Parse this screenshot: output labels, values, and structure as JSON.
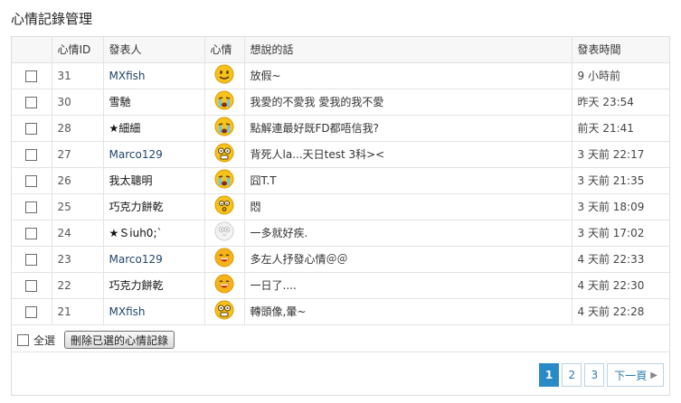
{
  "page": {
    "title": "心情記錄管理"
  },
  "table": {
    "headers": {
      "id": "心情ID",
      "user": "發表人",
      "mood": "心情",
      "text": "想說的話",
      "time": "發表時間"
    },
    "rows": [
      {
        "id": "31",
        "user": "MXfish",
        "user_style": "link",
        "mood": "smile-icon",
        "text": "放假~",
        "time": "9 小時前"
      },
      {
        "id": "30",
        "user": "雪馳",
        "user_style": "bold",
        "mood": "crying-icon",
        "text": "我愛的不愛我 愛我的我不愛",
        "time": "昨天 23:54"
      },
      {
        "id": "28",
        "user": "★細細",
        "user_style": "bold",
        "mood": "crying-icon",
        "text": "點解連最好既FD都唔信我?",
        "time": "前天 21:41"
      },
      {
        "id": "27",
        "user": "Marco129",
        "user_style": "link",
        "mood": "dizzy-icon",
        "text": "背死人la...天日test 3科><",
        "time": "3 天前 22:17"
      },
      {
        "id": "26",
        "user": "我太聰明",
        "user_style": "bold",
        "mood": "crying-icon",
        "text": "囧T.T",
        "time": "3 天前 21:35"
      },
      {
        "id": "25",
        "user": "巧克力餅乾",
        "user_style": "bold",
        "mood": "sulky-icon",
        "text": "悶",
        "time": "3 天前 18:09"
      },
      {
        "id": "24",
        "user": "★Ｓiuh0;`",
        "user_style": "bold",
        "mood": "ghost-icon",
        "text": "一多就好疾.",
        "time": "3 天前 17:02"
      },
      {
        "id": "23",
        "user": "Marco129",
        "user_style": "link",
        "mood": "grin-icon",
        "text": "多左人抒發心情＠＠",
        "time": "4 天前 22:33"
      },
      {
        "id": "22",
        "user": "巧克力餅乾",
        "user_style": "bold",
        "mood": "grin-icon",
        "text": "一日了....",
        "time": "4 天前 22:30"
      },
      {
        "id": "21",
        "user": "MXfish",
        "user_style": "link",
        "mood": "dizzy-icon",
        "text": "轉頭像,暈~",
        "time": "4 天前 22:28"
      }
    ]
  },
  "bulk": {
    "select_all_label": "全選",
    "delete_label": "刪除已選的心情記錄"
  },
  "pagination": {
    "pages": [
      "1",
      "2",
      "3"
    ],
    "current": "1",
    "next_label": "下一頁"
  },
  "colors": {
    "accent": "#2a8ac8",
    "face_yellow": "#f7c21b",
    "face_border": "#d89b06"
  }
}
